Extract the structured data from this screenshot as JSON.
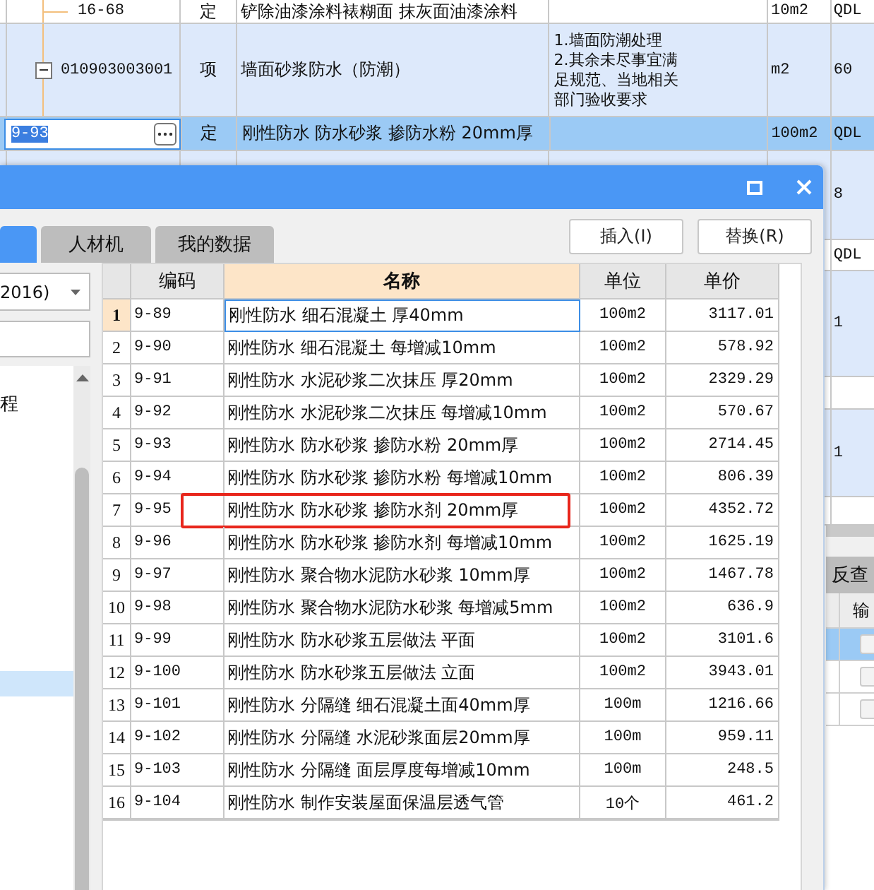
{
  "sheet": {
    "rows": [
      {
        "kind": "sub",
        "code": "16-68",
        "type": "定",
        "name": "铲除油漆涂料裱糊面 抹灰面油漆涂料",
        "unit": "10m2",
        "extra": "QDL",
        "selected": false,
        "shaded": false
      },
      {
        "kind": "item",
        "code": "010903003001",
        "expanded": true,
        "type": "项",
        "name": "墙面砂浆防水（防潮）",
        "feature": [
          "1.墙面防潮处理",
          "2.其余未尽事宜满足规范、当地相关部门验收要求"
        ],
        "unit": "m2",
        "extra": "60",
        "selected": false,
        "shaded": true
      },
      {
        "kind": "edit",
        "code": "9-93",
        "type": "定",
        "name": "刚性防水 防水砂浆 掺防水粉 20mm厚",
        "unit": "100m2",
        "extra": "QDL",
        "selected": true,
        "shaded": false
      }
    ],
    "side_rows": [
      {
        "value": "8",
        "shaded": true
      },
      {
        "value": "QDL",
        "shaded": false
      },
      {
        "value": "1",
        "shaded": true
      },
      {
        "shaded": false
      },
      {
        "value": "1",
        "shaded": true
      },
      {
        "shaded": false
      }
    ]
  },
  "bottom_panel": {
    "tabs": [
      {
        "label": "反查",
        "selected": false
      }
    ],
    "columns": [
      "输"
    ],
    "rows": [
      {
        "selected": true
      },
      {
        "selected": false
      },
      {
        "selected": false
      }
    ]
  },
  "dialog": {
    "tabs": [
      {
        "selected": true
      },
      {
        "label": "人材机",
        "selected": false
      },
      {
        "label": "我的数据",
        "selected": false
      }
    ],
    "buttons": [
      "插入(I)",
      "替换(R)"
    ],
    "library": {
      "value": "2016)"
    },
    "tree": [
      {
        "label": "程",
        "selected": false
      },
      {
        "selected": true
      }
    ],
    "table": {
      "columns": [
        {
          "label": "编码",
          "highlighted": false
        },
        {
          "label": "名称",
          "highlighted": true
        },
        {
          "label": "单位",
          "highlighted": false
        },
        {
          "label": "单价",
          "highlighted": false
        }
      ],
      "rows": [
        {
          "no": "1",
          "code": "9-89",
          "name": "刚性防水 细石混凝土 厚40mm",
          "unit": "100m2",
          "price": "3117.01",
          "selected": true,
          "marked": false
        },
        {
          "no": "2",
          "code": "9-90",
          "name": "刚性防水 细石混凝土 每增减10mm",
          "unit": "100m2",
          "price": "578.92",
          "selected": false,
          "marked": false
        },
        {
          "no": "3",
          "code": "9-91",
          "name": "刚性防水 水泥砂浆二次抹压 厚20mm",
          "unit": "100m2",
          "price": "2329.29",
          "selected": false,
          "marked": false
        },
        {
          "no": "4",
          "code": "9-92",
          "name": "刚性防水 水泥砂浆二次抹压 每增减10mm",
          "unit": "100m2",
          "price": "570.67",
          "selected": false,
          "marked": false
        },
        {
          "no": "5",
          "code": "9-93",
          "name": "刚性防水 防水砂浆 掺防水粉 20mm厚",
          "unit": "100m2",
          "price": "2714.45",
          "selected": false,
          "marked": false
        },
        {
          "no": "6",
          "code": "9-94",
          "name": "刚性防水 防水砂浆 掺防水粉 每增减10mm",
          "unit": "100m2",
          "price": "806.39",
          "selected": false,
          "marked": false
        },
        {
          "no": "7",
          "code": "9-95",
          "name": "刚性防水 防水砂浆 掺防水剂 20mm厚",
          "unit": "100m2",
          "price": "4352.72",
          "selected": false,
          "marked": true
        },
        {
          "no": "8",
          "code": "9-96",
          "name": "刚性防水 防水砂浆 掺防水剂 每增减10mm",
          "unit": "100m2",
          "price": "1625.19",
          "selected": false,
          "marked": false
        },
        {
          "no": "9",
          "code": "9-97",
          "name": "刚性防水 聚合物水泥防水砂浆 10mm厚",
          "unit": "100m2",
          "price": "1467.78",
          "selected": false,
          "marked": false
        },
        {
          "no": "10",
          "code": "9-98",
          "name": "刚性防水 聚合物水泥防水砂浆 每增减5mm",
          "unit": "100m2",
          "price": "636.9",
          "selected": false,
          "marked": false
        },
        {
          "no": "11",
          "code": "9-99",
          "name": "刚性防水 防水砂浆五层做法 平面",
          "unit": "100m2",
          "price": "3101.6",
          "selected": false,
          "marked": false
        },
        {
          "no": "12",
          "code": "9-100",
          "name": "刚性防水 防水砂浆五层做法 立面",
          "unit": "100m2",
          "price": "3943.01",
          "selected": false,
          "marked": false
        },
        {
          "no": "13",
          "code": "9-101",
          "name": "刚性防水 分隔缝 细石混凝土面40mm厚",
          "unit": "100m",
          "price": "1216.66",
          "selected": false,
          "marked": false
        },
        {
          "no": "14",
          "code": "9-102",
          "name": "刚性防水 分隔缝 水泥砂浆面层20mm厚",
          "unit": "100m",
          "price": "959.11",
          "selected": false,
          "marked": false
        },
        {
          "no": "15",
          "code": "9-103",
          "name": "刚性防水 分隔缝 面层厚度每增减10mm",
          "unit": "100m",
          "price": "248.5",
          "selected": false,
          "marked": false
        },
        {
          "no": "16",
          "code": "9-104",
          "name": "刚性防水 制作安装屋面保温层透气管",
          "unit": "10个",
          "price": "461.2",
          "selected": false,
          "marked": false
        }
      ]
    }
  }
}
